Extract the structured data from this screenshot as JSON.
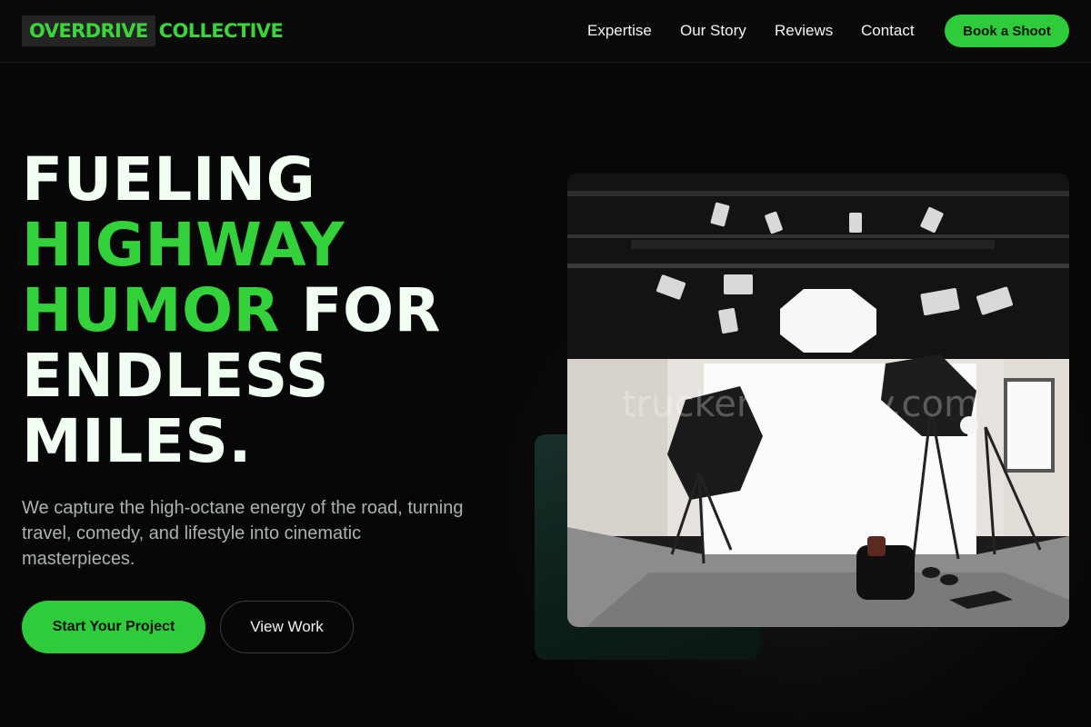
{
  "brand": {
    "part1": "OVERDRIVE",
    "part2": "COLLECTIVE"
  },
  "nav": {
    "links": [
      "Expertise",
      "Our Story",
      "Reviews",
      "Contact"
    ],
    "cta": "Book a Shoot"
  },
  "hero": {
    "headline": {
      "line1": "FUELING",
      "line2": "HIGHWAY",
      "line3_accent": "HUMOR",
      "line3_rest": " FOR",
      "line4": "ENDLESS",
      "line5": "MILES."
    },
    "subtitle": "We capture the high-octane energy of the road, turning travel, comedy, and lifestyle into cinematic masterpieces.",
    "primary_button": "Start Your Project",
    "secondary_button": "View Work"
  },
  "image": {
    "watermark": "truckercomedy.com"
  },
  "colors": {
    "accent": "#2ecc3a",
    "background": "#070707",
    "text": "#f0fff2",
    "muted": "#a9b3b3"
  }
}
